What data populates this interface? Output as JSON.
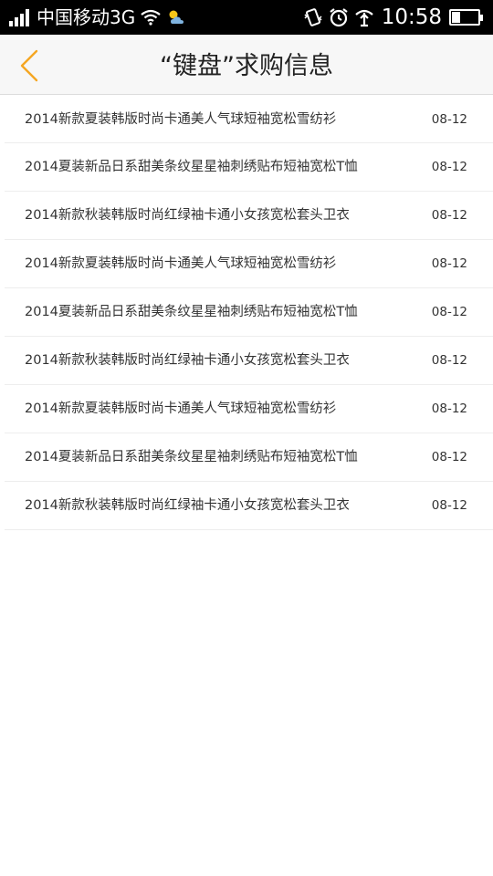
{
  "status_bar": {
    "carrier": "中国移动3G",
    "time": "10:58",
    "icons": [
      "signal-icon",
      "wifi-icon",
      "weather-icon",
      "vibrate-icon",
      "alarm-icon",
      "sync-icon",
      "battery-icon"
    ]
  },
  "header": {
    "title": "“键盘”求购信息",
    "back_icon": "chevron-left-icon",
    "accent_color": "#f5a623"
  },
  "items": [
    {
      "title": "2014新款夏装韩版时尚卡通美人气球短袖宽松雪纺衫",
      "date": "08-12"
    },
    {
      "title": "2014夏装新品日系甜美条纹星星袖刺绣贴布短袖宽松T恤",
      "date": "08-12"
    },
    {
      "title": "2014新款秋装韩版时尚红绿袖卡通小女孩宽松套头卫衣",
      "date": "08-12"
    },
    {
      "title": "2014新款夏装韩版时尚卡通美人气球短袖宽松雪纺衫",
      "date": "08-12"
    },
    {
      "title": "2014夏装新品日系甜美条纹星星袖刺绣贴布短袖宽松T恤",
      "date": "08-12"
    },
    {
      "title": "2014新款秋装韩版时尚红绿袖卡通小女孩宽松套头卫衣",
      "date": "08-12"
    },
    {
      "title": "2014新款夏装韩版时尚卡通美人气球短袖宽松雪纺衫",
      "date": "08-12"
    },
    {
      "title": "2014夏装新品日系甜美条纹星星袖刺绣贴布短袖宽松T恤",
      "date": "08-12"
    },
    {
      "title": "2014新款秋装韩版时尚红绿袖卡通小女孩宽松套头卫衣",
      "date": "08-12"
    }
  ]
}
